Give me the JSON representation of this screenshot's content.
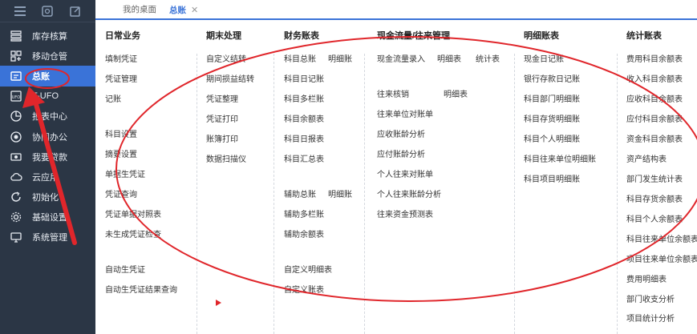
{
  "sidebar": {
    "top_icons": [
      "menu-icon",
      "search-doc-icon",
      "edit-icon"
    ],
    "items": [
      {
        "label": "库存核算",
        "icon": "inventory-icon"
      },
      {
        "label": "移动仓管",
        "icon": "grid-icon"
      },
      {
        "label": "总账",
        "icon": "ledger-icon"
      },
      {
        "label": "T-UFO",
        "icon": "ufo-icon"
      },
      {
        "label": "报表中心",
        "icon": "pie-chart-icon"
      },
      {
        "label": "协同办公",
        "icon": "collab-icon"
      },
      {
        "label": "我要贷款",
        "icon": "loan-icon"
      },
      {
        "label": "云应用",
        "icon": "cloud-icon"
      },
      {
        "label": "初始化",
        "icon": "init-icon"
      },
      {
        "label": "基础设置",
        "icon": "settings-icon"
      },
      {
        "label": "系统管理",
        "icon": "system-icon"
      }
    ]
  },
  "tabs": [
    {
      "label": "我的桌面"
    },
    {
      "label": "总账",
      "close": "✕"
    }
  ],
  "columns": {
    "daily": {
      "title": "日常业务",
      "items": [
        "填制凭证",
        "凭证管理",
        "记账",
        "科目设置",
        "摘要设置",
        "单据生凭证",
        "凭证查询",
        "凭证单据对照表",
        "未生成凭证检查",
        "自动生凭证",
        "自动生凭证结果查询"
      ]
    },
    "period_end": {
      "title": "期末处理",
      "items": [
        "自定义结转",
        "期间损益结转",
        "凭证整理",
        "凭证打印",
        "账簿打印",
        "数据扫描仪"
      ]
    },
    "finance": {
      "title": "财务账表",
      "items": [
        "科目总账",
        "明细账",
        "科目日记账",
        "科目多栏账",
        "科目余额表",
        "科目日报表",
        "科目汇总表",
        "辅助总账",
        "明细账",
        "辅助多栏账",
        "辅助余额表",
        "自定义明细表",
        "自定义账表"
      ]
    },
    "cashflow": {
      "title": "现金流量/往来管理",
      "items": [
        "现金流量录入",
        "明细表",
        "统计表",
        "往来核销",
        "明细表",
        "往来单位对账单",
        "应收账龄分析",
        "应付账龄分析",
        "个人往来对账单",
        "个人往来账龄分析",
        "往来资金预测表"
      ]
    },
    "detail": {
      "title": "明细账表",
      "items": [
        "现金日记账",
        "银行存款日记账",
        "科目部门明细账",
        "科目存货明细账",
        "科目个人明细账",
        "科目往来单位明细账",
        "科目项目明细账"
      ]
    },
    "stats": {
      "title": "统计账表",
      "items": [
        "费用科目余额表",
        "收入科目余额表",
        "应收科目余额表",
        "应付科目余额表",
        "资金科目余额表",
        "资产结构表",
        "部门发生统计表",
        "科目存货余额表",
        "科目个人余额表",
        "科目往来单位余额表",
        "项目往来单位余额表",
        "费用明细表",
        "部门收支分析",
        "项目统计分析"
      ]
    }
  },
  "colors": {
    "sidebar_bg": "#2b3645",
    "accent": "#3a73d8",
    "annotation": "#e0262b"
  }
}
